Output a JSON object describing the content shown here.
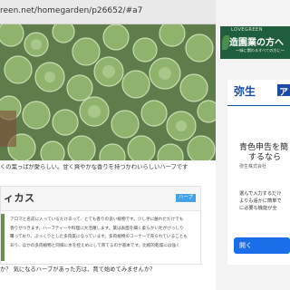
{
  "browser": {
    "url": "reen.net/homegarden/p26652/#a7"
  },
  "article": {
    "caption": "くの葉っぱが愛らしい。甘く爽やかな香りを持つかわいらしいハーブです",
    "card": {
      "title": "ィカス",
      "tag": "ハーブ",
      "body_lines": [
        "アロマと名前に入っているだけあって、とても香りの良い植物です。少し手に触れただけでも",
        "香りがつきます。ハーブティーや料理に大活躍します。葉は表面を細く柔らかい毛がびっしり",
        "覆っており、ぷっくりとした多肉質になっています。多肉植物のコーナーで売られていることも",
        "あり、ほかの多肉植物と同様に水を控えめにして育てるのが基本です。比較的乾燥には強く"
      ]
    },
    "question": "か？ 気になるハーブがあった方は、育て始めてみませんか？"
  },
  "ad_top": {
    "brand": "LOVEGREEN",
    "headline": "造園業の方へ",
    "sub": "〜緑に関わるすべての方に〜"
  },
  "ad_main": {
    "logo_text": "弥生",
    "logo_mark": "ア",
    "headline_1": "青色申告を簡",
    "headline_2": "するなら",
    "company": "弥生株式会社",
    "desc_lines": [
      "選んで入力するだけ",
      "よりも遥かに簡単で",
      "に必要な機能が全"
    ],
    "button_label": "開く"
  },
  "colors": {
    "tag_blue": "#43a1e6",
    "ad_green": "#1f5e3d",
    "brand_blue": "#1a4aa3",
    "button_blue": "#1a6ee8"
  }
}
